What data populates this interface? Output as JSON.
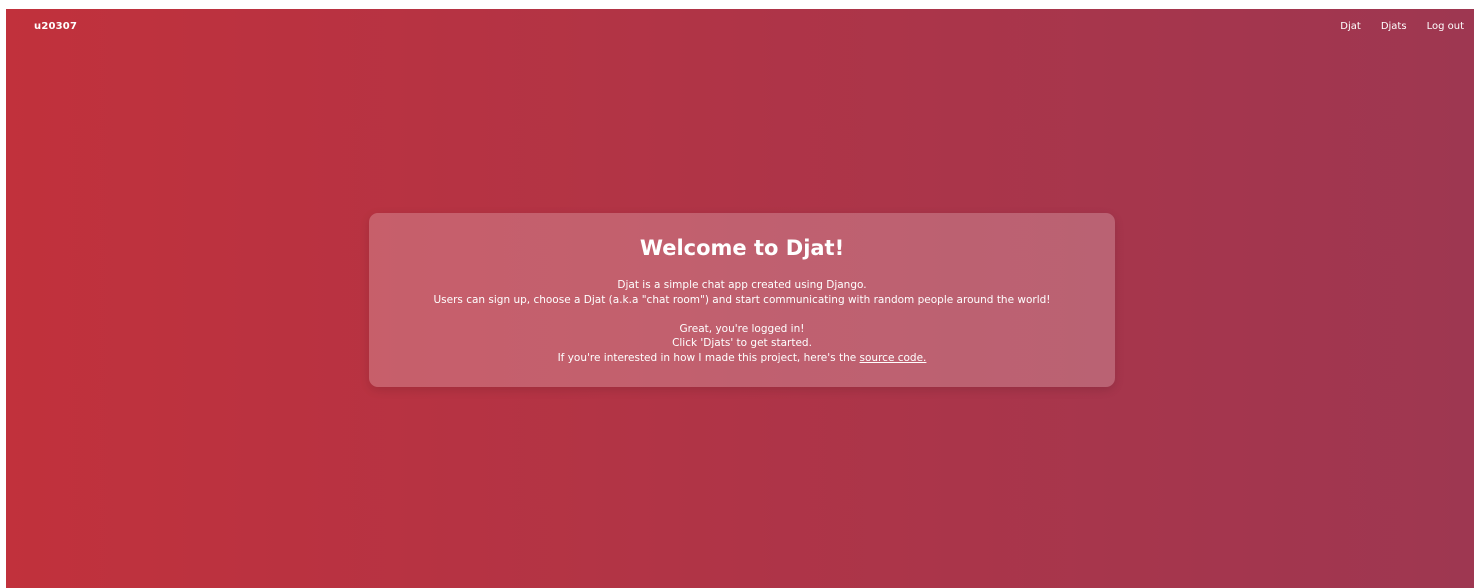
{
  "navbar": {
    "brand": "u20307",
    "links": [
      {
        "label": "Djat"
      },
      {
        "label": "Djats"
      },
      {
        "label": "Log out"
      }
    ]
  },
  "welcome": {
    "title": "Welcome to Djat!",
    "description_line1": "Djat is a simple chat app created using Django.",
    "description_line2": "Users can sign up, choose a Djat (a.k.a \"chat room\") and start communicating with random people around the world!",
    "logged_in_line": "Great, you're logged in!",
    "instruction_line": "Click 'Djats' to get started.",
    "source_prefix": "If you're interested in how I made this project, here's the ",
    "source_link_label": "source code."
  },
  "colors": {
    "gradient_start": "#c1313c",
    "gradient_end": "#9e3751",
    "text": "#ffffff"
  }
}
